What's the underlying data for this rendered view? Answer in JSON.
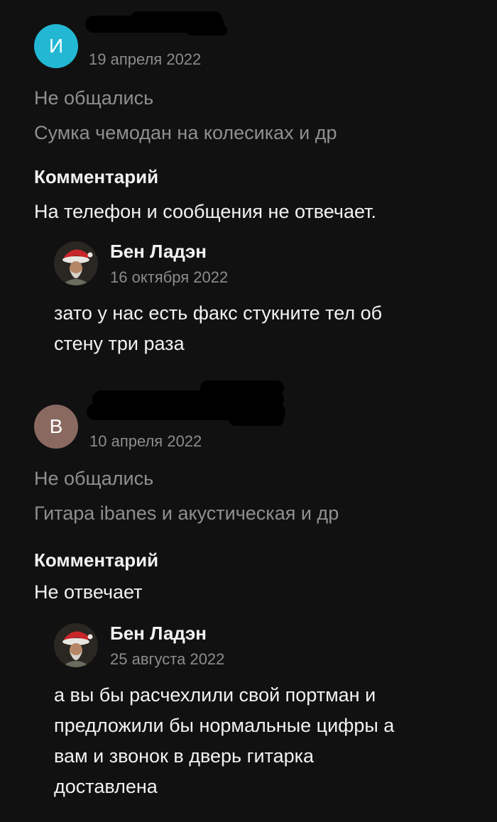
{
  "reviews": [
    {
      "avatar_letter": "И",
      "avatar_color": "#22b8d4",
      "date": "19 апреля 2022",
      "status": "Не общались",
      "item": "Сумка чемодан на колесиках и др",
      "comment_heading": "Комментарий",
      "comment": "На телефон и сообщения не отвечает.",
      "reply": {
        "name": "Бен Ладэн",
        "date": "16 октября 2022",
        "text": "зато у нас есть факс стукните тел об\nстену три раза"
      }
    },
    {
      "avatar_letter": "В",
      "avatar_color": "#8a6960",
      "date": "10 апреля 2022",
      "status": "Не общались",
      "item": "Гитара ibanes и акустическая и др",
      "comment_heading": "Комментарий",
      "comment": "Не отвечает",
      "reply": {
        "name": "Бен Ладэн",
        "date": "25 августа 2022",
        "text": "а вы бы расчехлили свой портман и\nпредложили бы нормальные цифры а\nвам и звонок в дверь гитарка\nдоставлена"
      }
    }
  ],
  "icons": {
    "redacted_name": "redacted-name-scribble",
    "reply_avatar": "santa-hat-portrait-avatar"
  }
}
